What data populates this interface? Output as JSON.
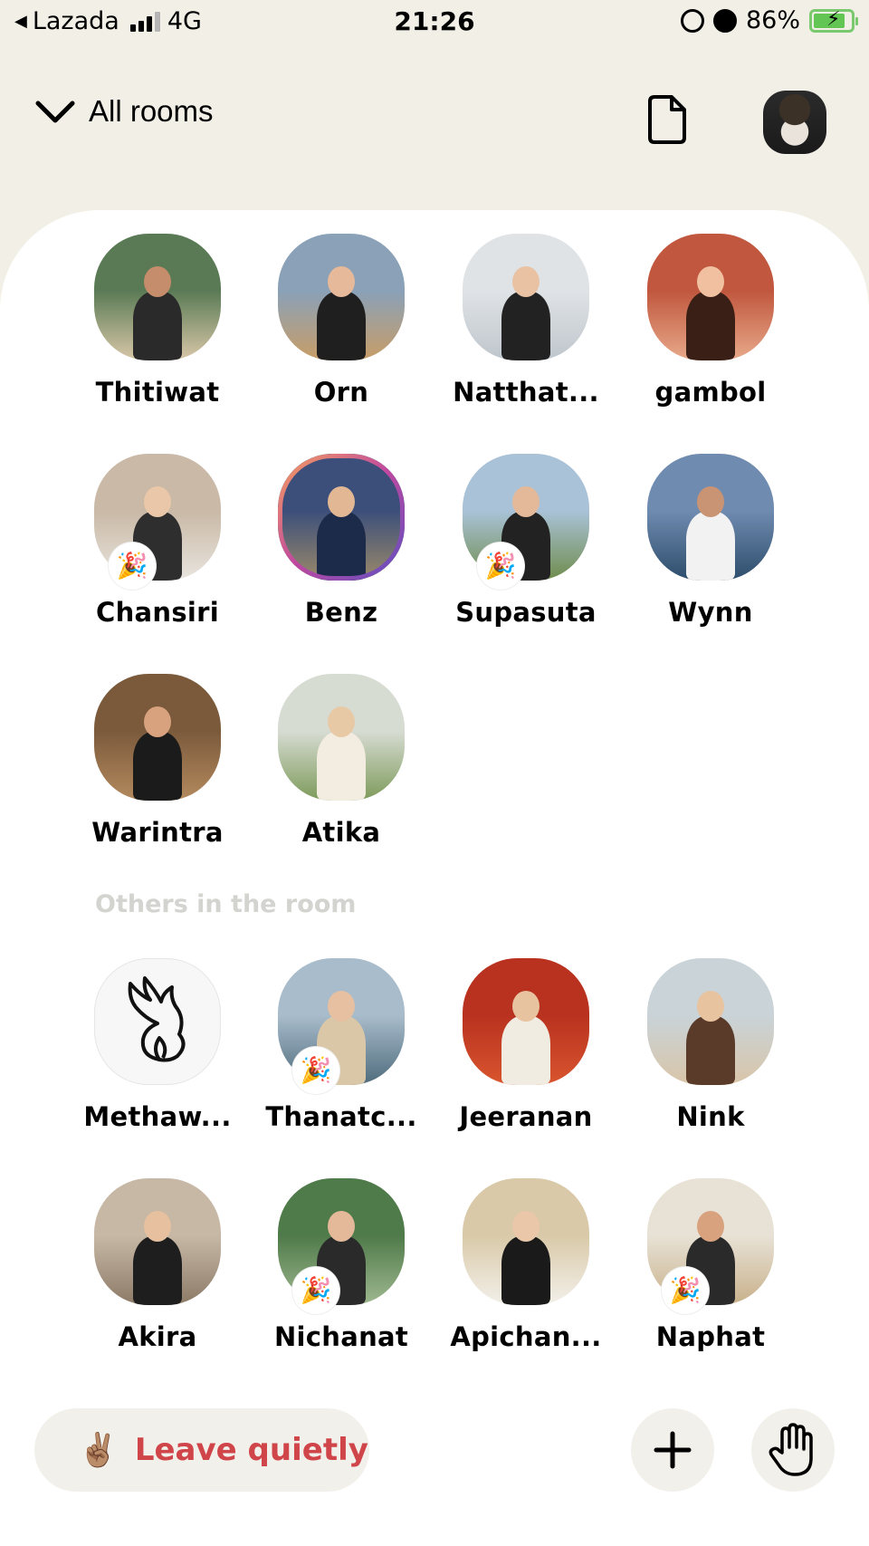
{
  "status_bar": {
    "carrier": "Lazada",
    "network": "4G",
    "time": "21:26",
    "battery": "86%"
  },
  "header": {
    "rooms_label": "All rooms"
  },
  "speakers": [
    {
      "name": "Thitiwat",
      "party": false
    },
    {
      "name": "Orn",
      "party": false
    },
    {
      "name": "Natthat...",
      "party": false
    },
    {
      "name": "gambol",
      "party": false
    },
    {
      "name": "Chansiri",
      "party": true
    },
    {
      "name": "Benz",
      "party": false,
      "ring": true
    },
    {
      "name": "Supasuta",
      "party": true
    },
    {
      "name": "Wynn",
      "party": false
    },
    {
      "name": "Warintra",
      "party": false
    },
    {
      "name": "Atika",
      "party": false
    }
  ],
  "others_label": "Others in the room",
  "others": [
    {
      "name": "Methaw...",
      "party": false
    },
    {
      "name": "Thanatc...",
      "party": true
    },
    {
      "name": "Jeeranan",
      "party": false
    },
    {
      "name": "Nink",
      "party": false
    },
    {
      "name": "Akira",
      "party": false
    },
    {
      "name": "Nichanat",
      "party": true
    },
    {
      "name": "Apichan...",
      "party": false
    },
    {
      "name": "Naphat",
      "party": true
    }
  ],
  "footer": {
    "leave_emoji": "✌🏽",
    "leave_label": "Leave quietly"
  },
  "icons": {
    "party": "🎉",
    "plus": "plus-icon",
    "hand": "raise-hand-icon"
  },
  "colors": {
    "background": "#f1efe6",
    "leave_text": "#d0454a",
    "battery": "#62c554"
  }
}
